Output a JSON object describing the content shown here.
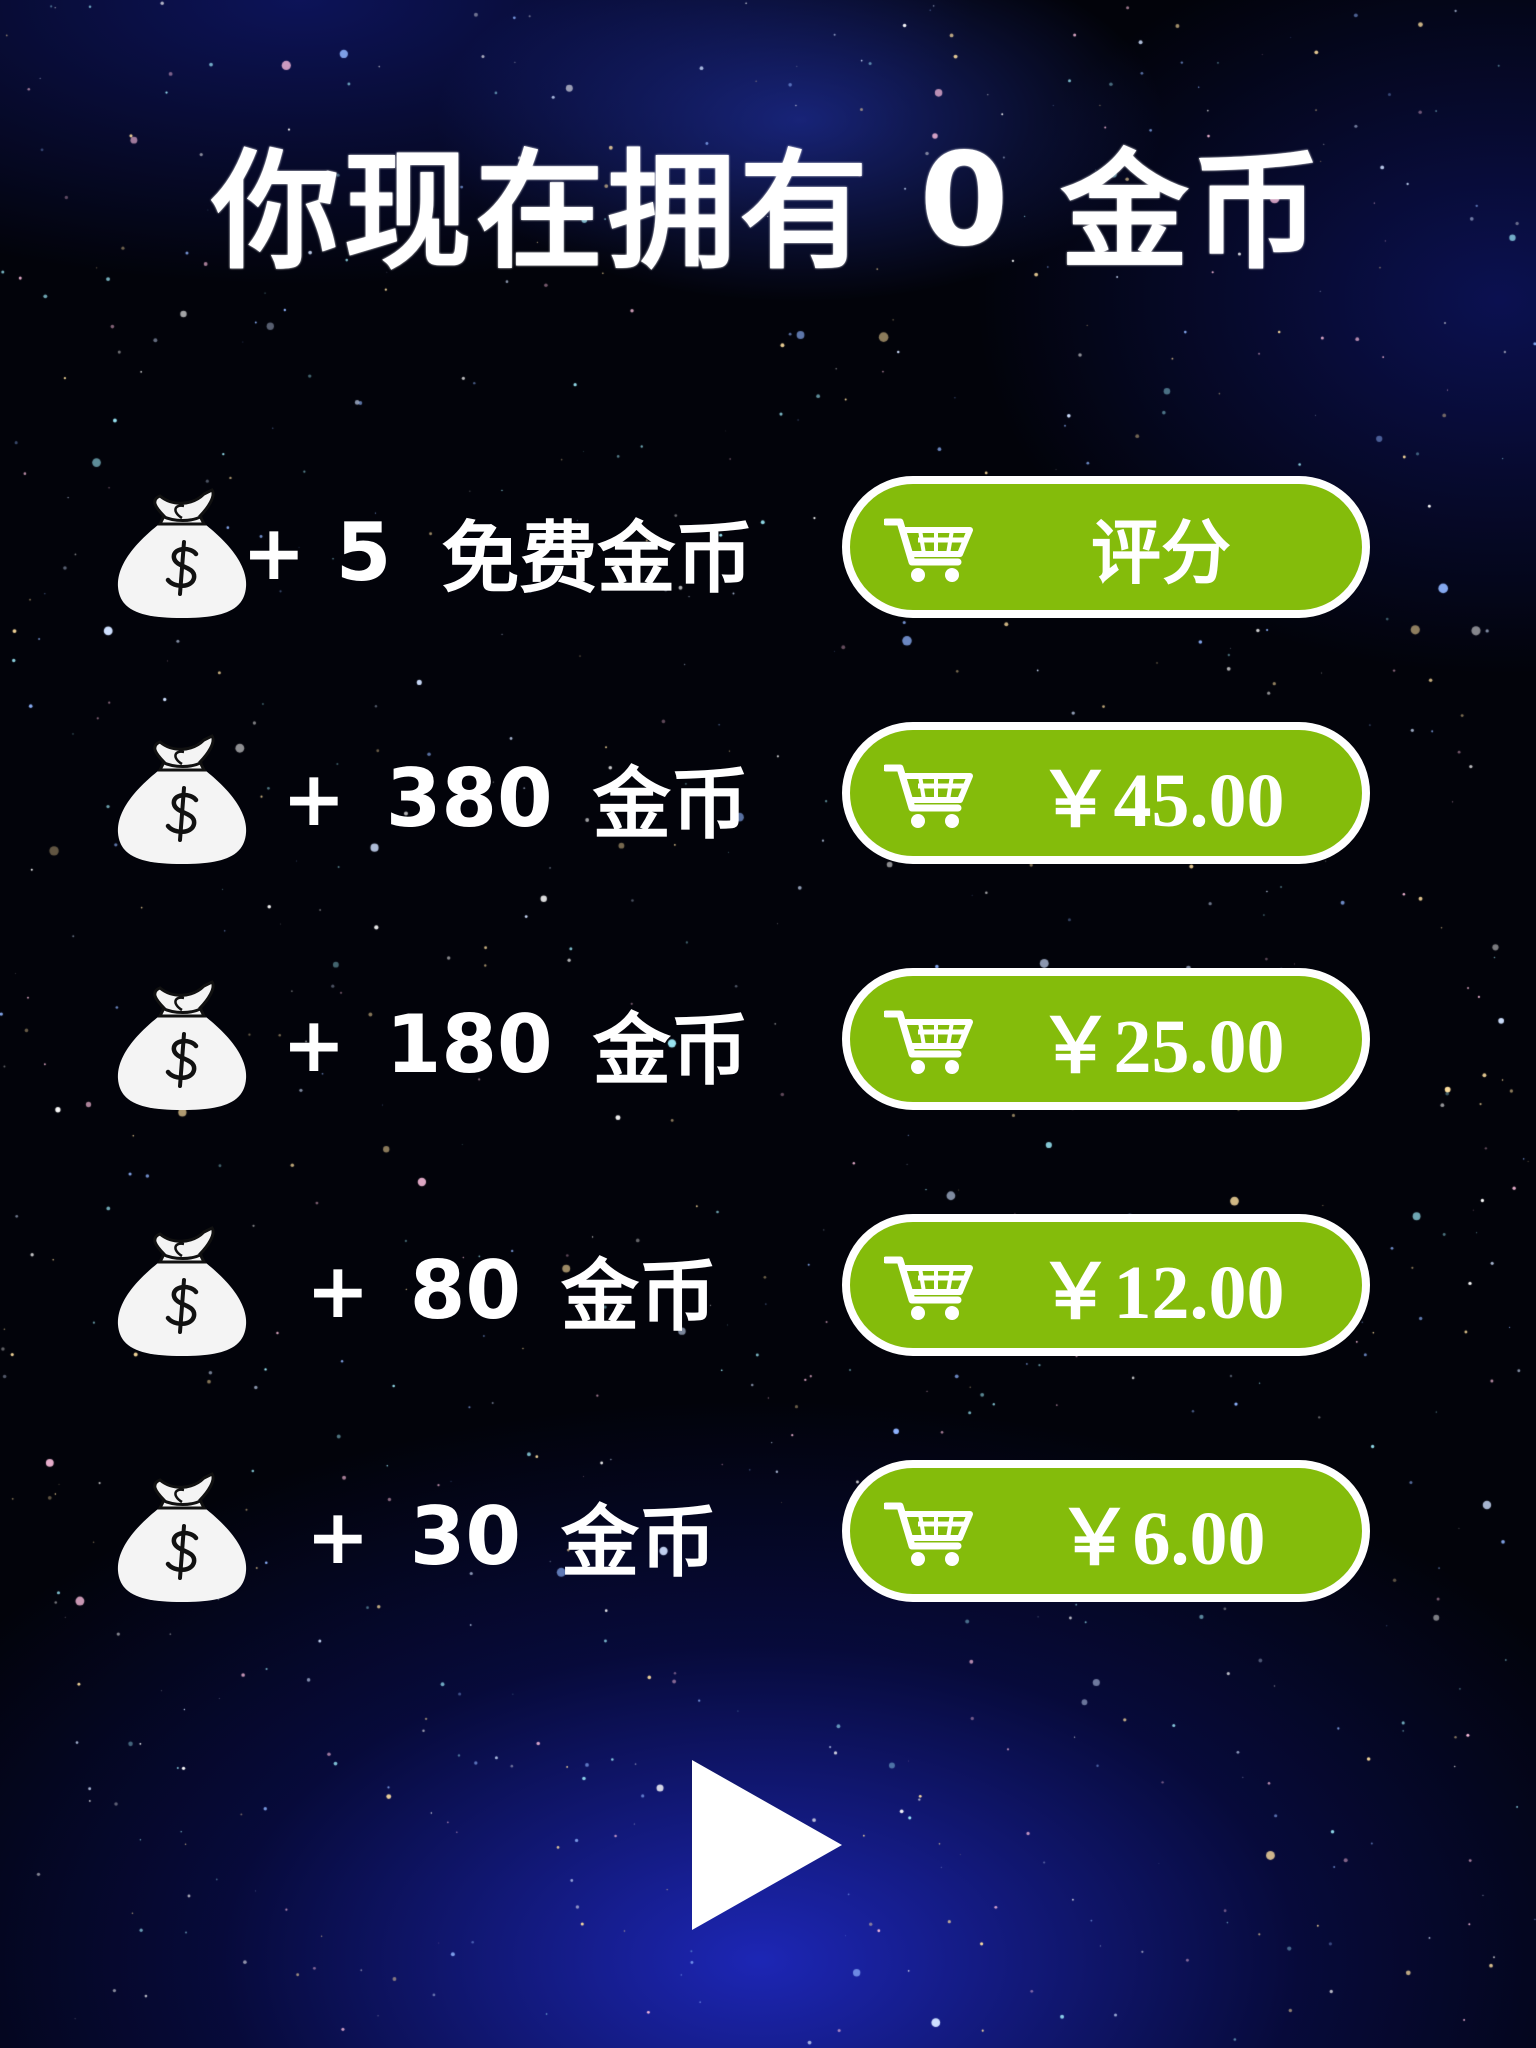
{
  "header": {
    "prefix": "你现在拥有",
    "coins": "0",
    "suffix": "金币"
  },
  "offers": [
    {
      "plus": "+",
      "amount": "5",
      "unit": "免费金币",
      "price": "评分",
      "icon": "money-bag-icon",
      "button_icon": "shopping-cart-icon"
    },
    {
      "plus": "+",
      "amount": "380",
      "unit": "金币",
      "price": "￥45.00",
      "icon": "money-bag-icon",
      "button_icon": "shopping-cart-icon"
    },
    {
      "plus": "+",
      "amount": "180",
      "unit": "金币",
      "price": "￥25.00",
      "icon": "money-bag-icon",
      "button_icon": "shopping-cart-icon"
    },
    {
      "plus": "+",
      "amount": "80",
      "unit": "金币",
      "price": "￥12.00",
      "icon": "money-bag-icon",
      "button_icon": "shopping-cart-icon"
    },
    {
      "plus": "+",
      "amount": "30",
      "unit": "金币",
      "price": "￥6.00",
      "icon": "money-bag-icon",
      "button_icon": "shopping-cart-icon"
    }
  ],
  "play": {
    "icon": "play-icon"
  },
  "colors": {
    "button_green": "#84bc0b",
    "button_border": "#ffffff",
    "text": "#ffffff",
    "background_dark": "#02030a",
    "background_blue": "#1e28be"
  }
}
